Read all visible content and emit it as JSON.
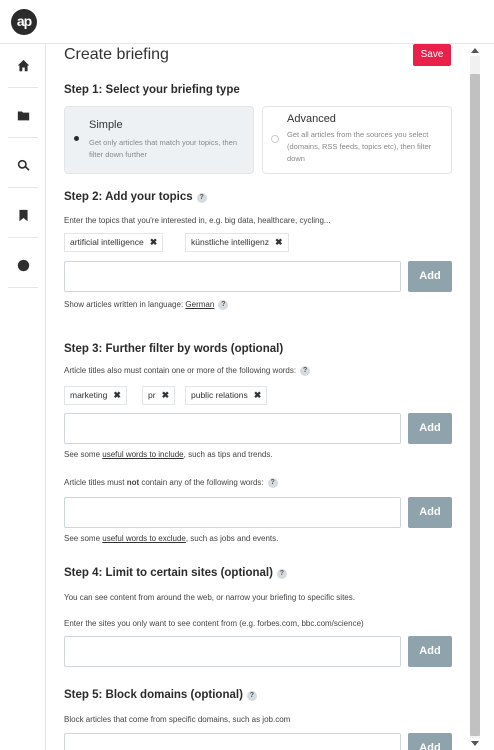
{
  "app": {
    "logo_text": "ap"
  },
  "sidebar": {
    "items": [
      {
        "name": "home",
        "icon": "home-icon"
      },
      {
        "name": "folder",
        "icon": "folder-icon"
      },
      {
        "name": "search",
        "icon": "search-icon"
      },
      {
        "name": "bookmark",
        "icon": "bookmark-icon"
      },
      {
        "name": "globe",
        "icon": "globe-icon"
      }
    ]
  },
  "header": {
    "title": "Create briefing",
    "save_label": "Save"
  },
  "step1": {
    "title": "Step 1: Select your briefing type",
    "options": [
      {
        "label": "Simple",
        "description": "Get only articles that match your topics, then filter down further",
        "selected": true
      },
      {
        "label": "Advanced",
        "description": "Get all articles from the sources you select (domains, RSS feeds, topics etc), then filter down",
        "selected": false
      }
    ]
  },
  "step2": {
    "title": "Step 2: Add your topics",
    "help": "?",
    "instructions": "Enter the topics that you're interested in, e.g. big data, healthcare, cycling...",
    "tags": [
      "artificial intelligence",
      "künstliche intelligenz"
    ],
    "input_value": "",
    "add_label": "Add",
    "language_text": "Show articles written in language:",
    "language_value": "German"
  },
  "step3": {
    "title": "Step 3: Further filter by words (optional)",
    "include_instructions": "Article titles also must contain one or more of the following words:",
    "include_tags": [
      "marketing",
      "pr",
      "public relations"
    ],
    "include_input_value": "",
    "include_hint_prefix": "See some ",
    "include_hint_link": "useful words to include",
    "include_hint_suffix": ", such as tips and trends.",
    "exclude_prefix": "Article titles must ",
    "exclude_bold": "not",
    "exclude_suffix": " contain any of the following words:",
    "exclude_input_value": "",
    "exclude_hint_prefix": "See some ",
    "exclude_hint_link": "useful words to exclude",
    "exclude_hint_suffix": ", such as jobs and events.",
    "add_label": "Add"
  },
  "step4": {
    "title": "Step 4: Limit to certain sites (optional)",
    "description": "You can see content from around the web, or narrow your briefing to specific sites.",
    "instructions": "Enter the sites you only want to see content from (e.g. forbes.com, bbc.com/science)",
    "input_value": "",
    "add_label": "Add"
  },
  "step5": {
    "title": "Step 5: Block domains (optional)",
    "description": "Block articles that come from specific domains, such as job.com",
    "add_label": "Add"
  },
  "tag_remove_glyph": "✖",
  "colors": {
    "save": "#e8204a",
    "add_button": "#8fa3ad",
    "active_card": "#edf1f4"
  }
}
